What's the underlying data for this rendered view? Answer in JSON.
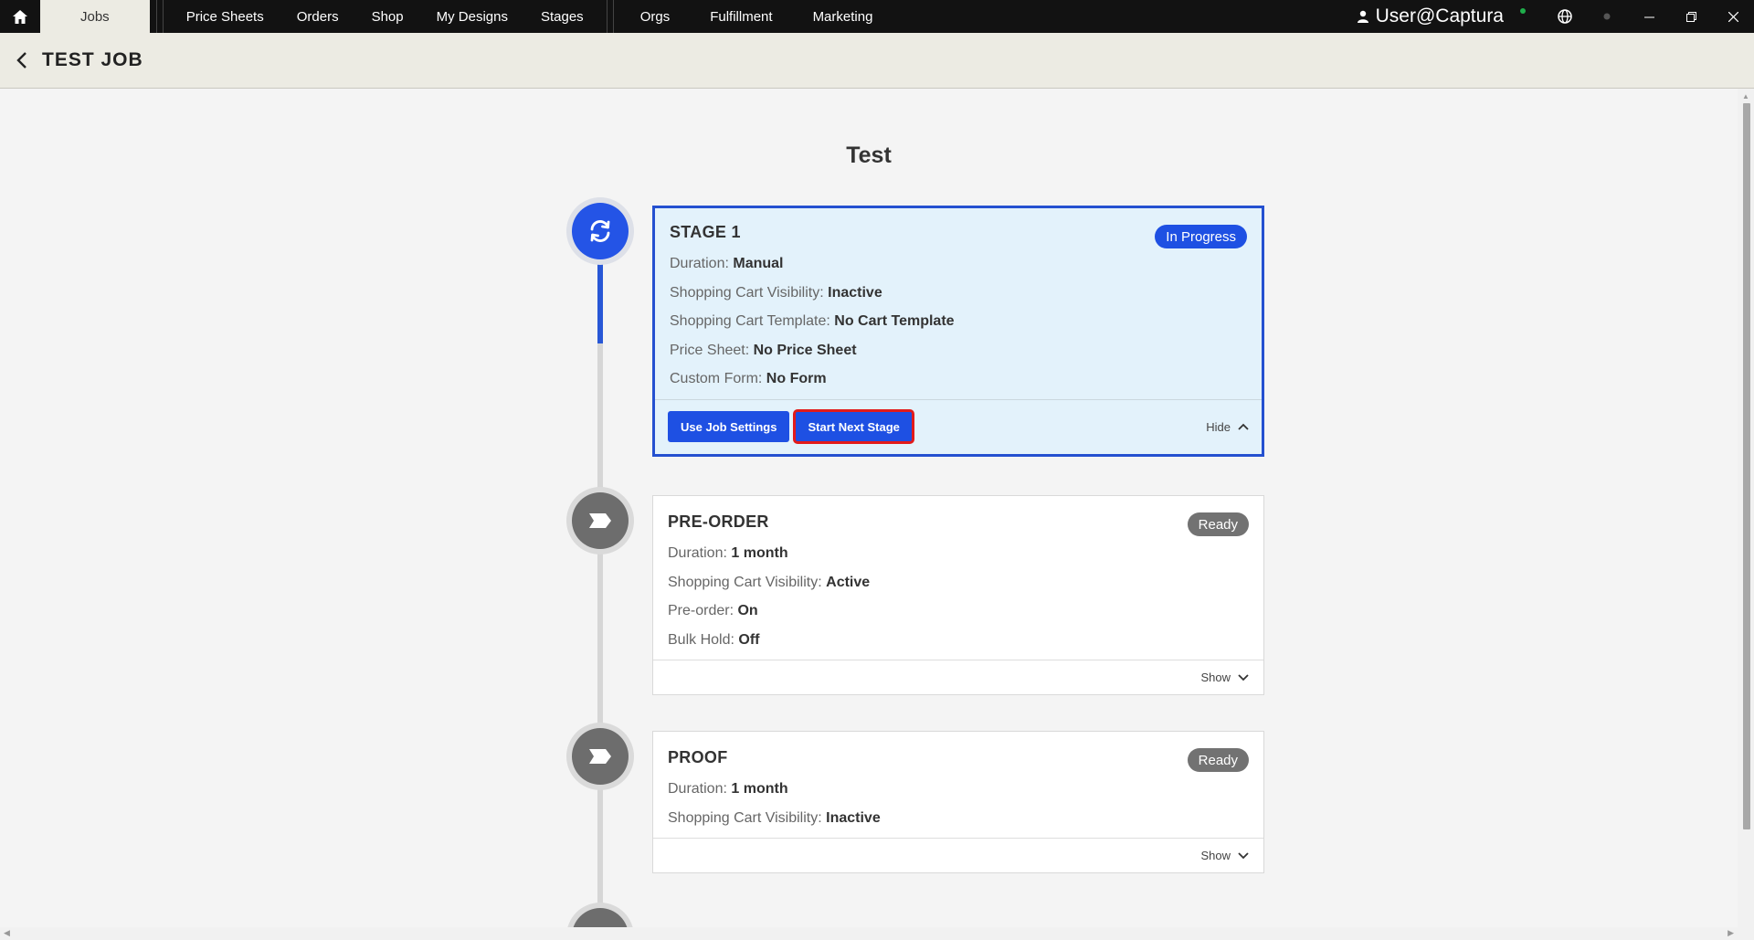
{
  "nav": {
    "tabs": [
      "Jobs",
      "Price Sheets",
      "Orders",
      "Shop",
      "My Designs",
      "Stages"
    ],
    "tabs2": [
      "Orgs",
      "Fulfillment",
      "Marketing"
    ],
    "user": "User@Captura"
  },
  "header": {
    "title": "TEST JOB"
  },
  "job": {
    "name": "Test"
  },
  "stages": [
    {
      "title": "STAGE 1",
      "status": "In Progress",
      "rows": [
        {
          "label": "Duration:",
          "value": "Manual"
        },
        {
          "label": "Shopping Cart Visibility:",
          "value": "Inactive"
        },
        {
          "label": "Shopping Cart Template:",
          "value": "No Cart Template"
        },
        {
          "label": "Price Sheet:",
          "value": "No Price Sheet"
        },
        {
          "label": "Custom Form:",
          "value": "No Form"
        }
      ],
      "buttons": {
        "job_settings": "Use Job Settings",
        "next_stage": "Start Next Stage"
      },
      "toggle": "Hide"
    },
    {
      "title": "PRE-ORDER",
      "status": "Ready",
      "rows": [
        {
          "label": "Duration:",
          "value": "1 month"
        },
        {
          "label": "Shopping Cart Visibility:",
          "value": "Active"
        },
        {
          "label": "Pre-order:",
          "value": "On"
        },
        {
          "label": "Bulk Hold:",
          "value": "Off"
        }
      ],
      "toggle": "Show"
    },
    {
      "title": "PROOF",
      "status": "Ready",
      "rows": [
        {
          "label": "Duration:",
          "value": "1 month"
        },
        {
          "label": "Shopping Cart Visibility:",
          "value": "Inactive"
        }
      ],
      "toggle": "Show"
    }
  ],
  "colors": {
    "accent": "#1e50e3",
    "highlight": "#e21b1b",
    "ready": "#727272"
  }
}
